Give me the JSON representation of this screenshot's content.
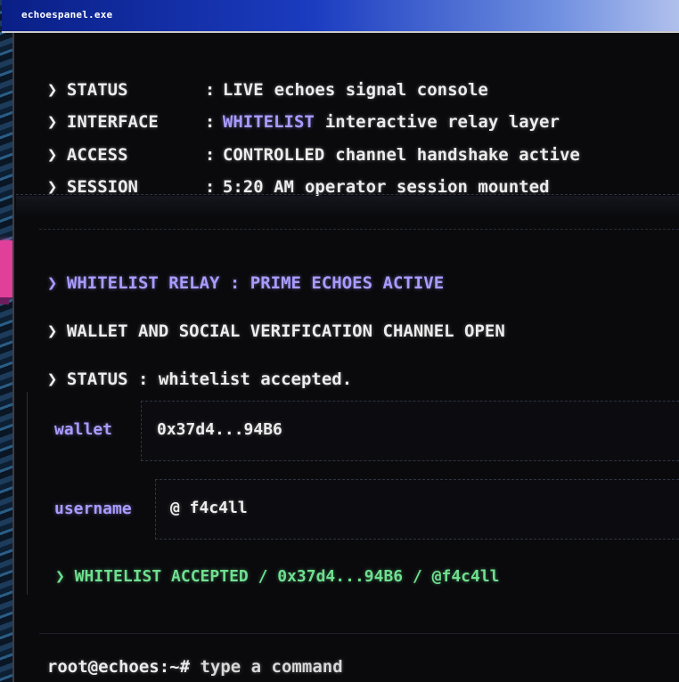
{
  "window": {
    "title": "echoespanel.exe"
  },
  "status_block": [
    {
      "chevron": "❯",
      "key": "STATUS",
      "value": "LIVE",
      "value_highlight": false,
      "detail": "echoes signal console"
    },
    {
      "chevron": "❯",
      "key": "INTERFACE",
      "value": "WHITELIST",
      "value_highlight": true,
      "detail": "interactive relay layer"
    },
    {
      "chevron": "❯",
      "key": "ACCESS",
      "value": "CONTROLLED",
      "value_highlight": false,
      "detail": "channel handshake active"
    },
    {
      "chevron": "❯",
      "key": "SESSION",
      "value": "5:20 AM",
      "value_highlight": false,
      "detail": "operator session mounted"
    }
  ],
  "colon": ":",
  "log": {
    "relay": {
      "chevron": "❯",
      "text": "WHITELIST RELAY : PRIME ECHOES ACTIVE"
    },
    "channel": {
      "chevron": "❯",
      "text": "WALLET AND SOCIAL VERIFICATION CHANNEL OPEN"
    },
    "status": {
      "chevron": "❯",
      "text": "STATUS : whitelist accepted."
    }
  },
  "form": {
    "wallet_label": "wallet",
    "wallet_value": "0x37d4...94B6",
    "username_label": "username",
    "username_value": "@ f4c4ll",
    "confirmation": "❯ WHITELIST ACCEPTED / 0x37d4...94B6 / @f4c4ll"
  },
  "prompt": {
    "prefix": "root@echoes:~# ",
    "placeholder": "type a command"
  },
  "colors": {
    "accent_purple": "#a99bff",
    "success_green": "#6fdf8f",
    "titlebar_blue": "#1b3cc0",
    "background": "#0a0a0d"
  }
}
